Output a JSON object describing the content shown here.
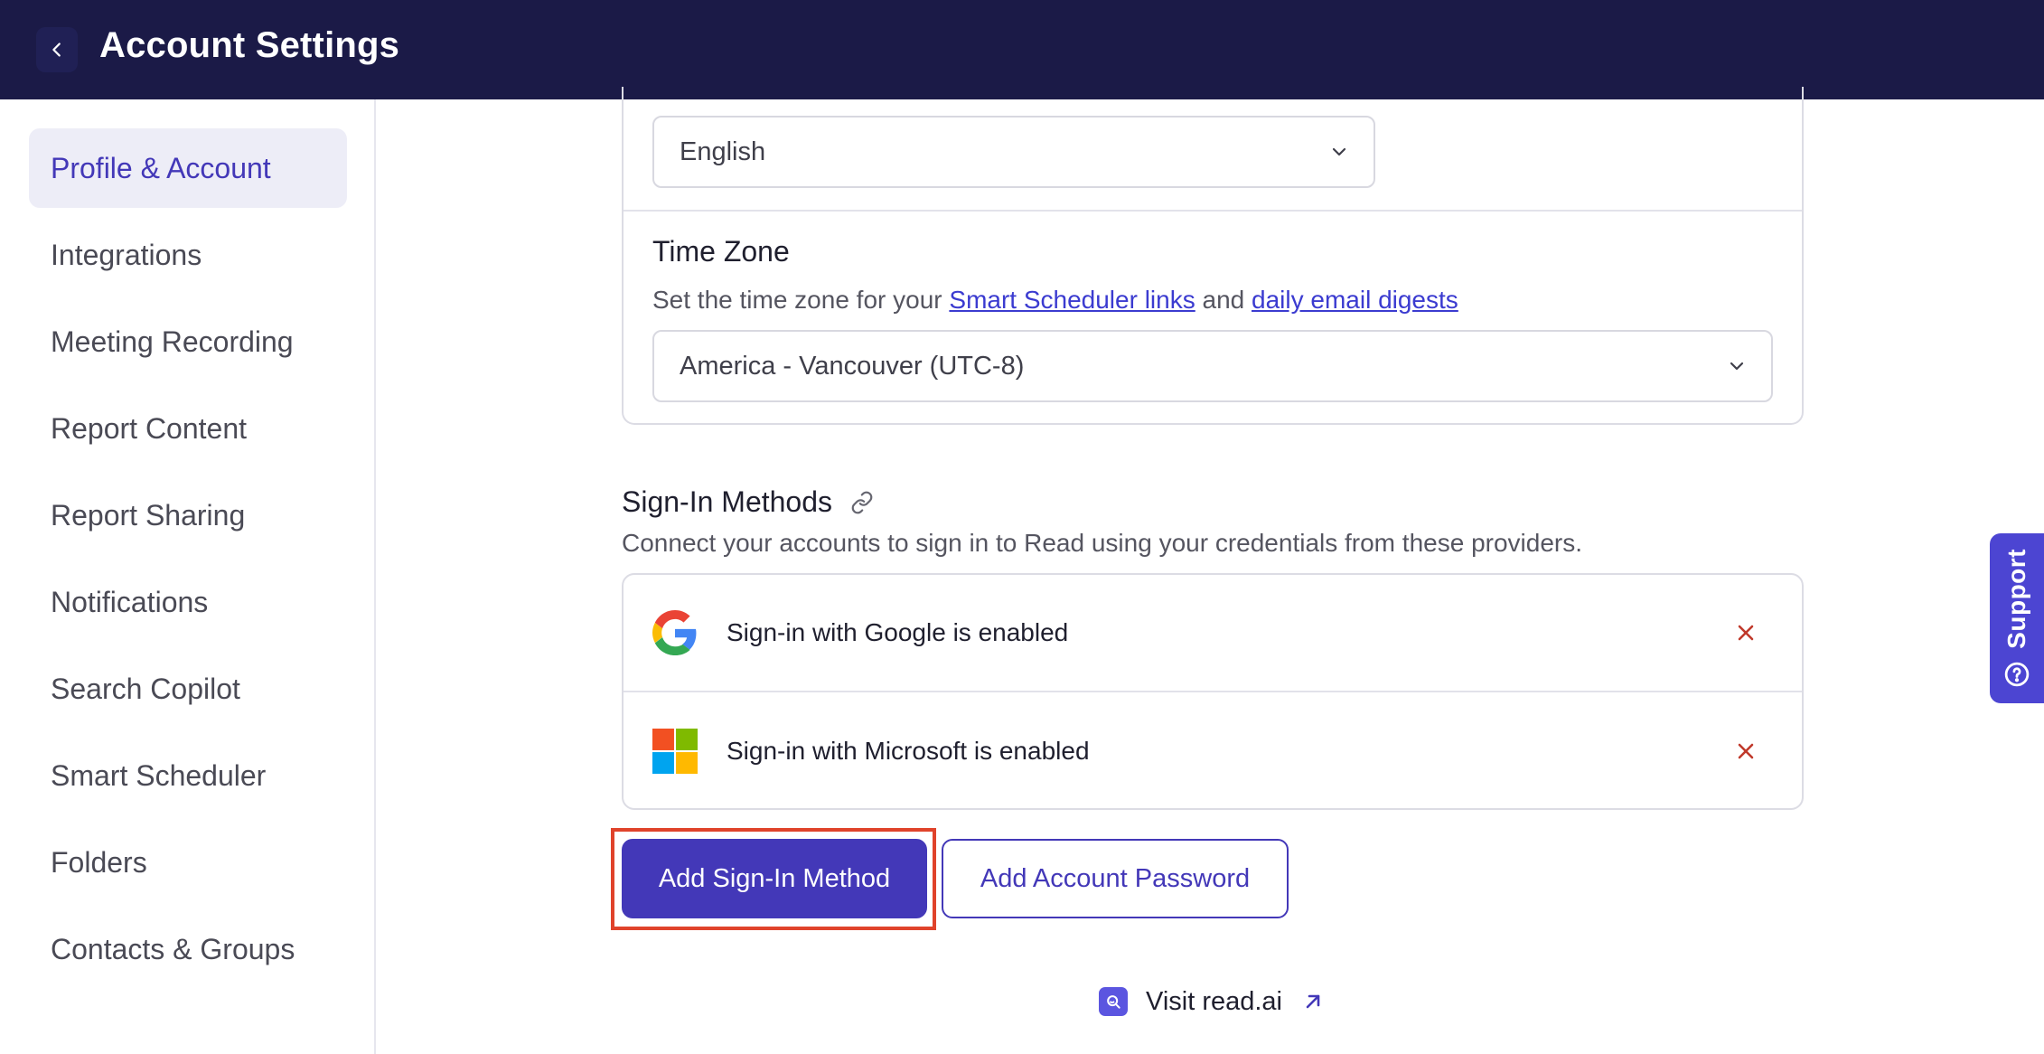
{
  "header": {
    "title": "Account Settings",
    "back_icon": "chevron-left-icon"
  },
  "sidebar": {
    "items": [
      {
        "label": "Profile & Account",
        "active": true
      },
      {
        "label": "Integrations"
      },
      {
        "label": "Meeting Recording"
      },
      {
        "label": "Report Content"
      },
      {
        "label": "Report Sharing"
      },
      {
        "label": "Notifications"
      },
      {
        "label": "Search Copilot"
      },
      {
        "label": "Smart Scheduler"
      },
      {
        "label": "Folders"
      },
      {
        "label": "Contacts & Groups"
      }
    ]
  },
  "language": {
    "selected": "English"
  },
  "timezone": {
    "title": "Time Zone",
    "desc_prefix": "Set the time zone for your ",
    "link1": "Smart Scheduler links",
    "desc_mid": " and ",
    "link2": "daily email digests",
    "selected": "America - Vancouver (UTC-8)"
  },
  "sign_in_methods": {
    "title": "Sign-In Methods",
    "description": "Connect your accounts to sign in to Read using your credentials from these providers.",
    "providers": [
      {
        "label": "Sign-in with Google is enabled",
        "icon": "google-icon"
      },
      {
        "label": "Sign-in with Microsoft is enabled",
        "icon": "microsoft-icon"
      }
    ],
    "add_method_label": "Add Sign-In Method",
    "add_password_label": "Add Account Password"
  },
  "footer": {
    "visit_label": "Visit read.ai"
  },
  "support": {
    "label": "Support"
  },
  "colors": {
    "header_bg": "#1b1a47",
    "accent": "#4338b8",
    "remove": "#c0392b",
    "highlight": "#e0432b"
  }
}
